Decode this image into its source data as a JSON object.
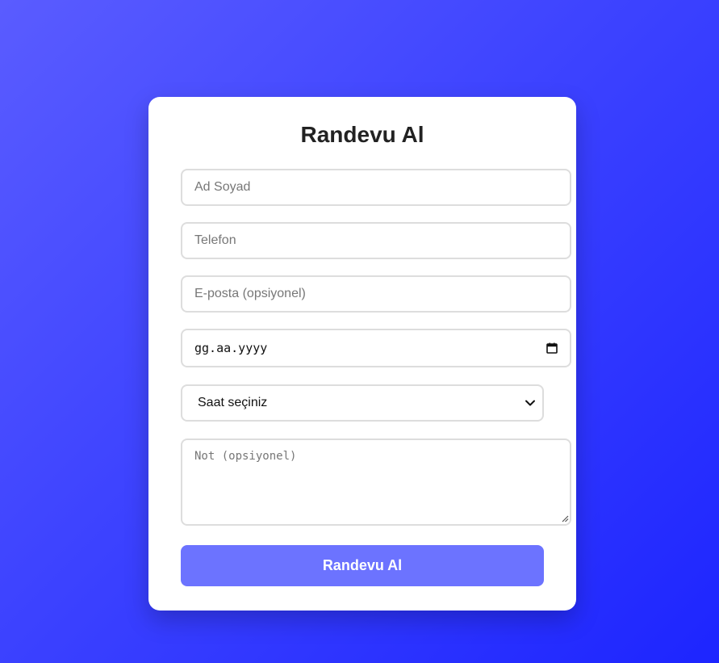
{
  "form": {
    "title": "Randevu Al",
    "name": {
      "placeholder": "Ad Soyad",
      "value": ""
    },
    "phone": {
      "placeholder": "Telefon",
      "value": ""
    },
    "email": {
      "placeholder": "E-posta (opsiyonel)",
      "value": ""
    },
    "date": {
      "display": "gg.aa.yyyy",
      "icon": "calendar-icon"
    },
    "time": {
      "selected": "Saat seçiniz",
      "icon": "chevron-down-icon"
    },
    "note": {
      "placeholder": "Not (opsiyonel)",
      "value": ""
    },
    "submit_label": "Randevu Al"
  },
  "colors": {
    "background_start": "#5a5cff",
    "background_end": "#1d25ff",
    "card": "#ffffff",
    "button": "#6c73ff",
    "field_border": "#dddddd",
    "title_text": "#222222"
  }
}
